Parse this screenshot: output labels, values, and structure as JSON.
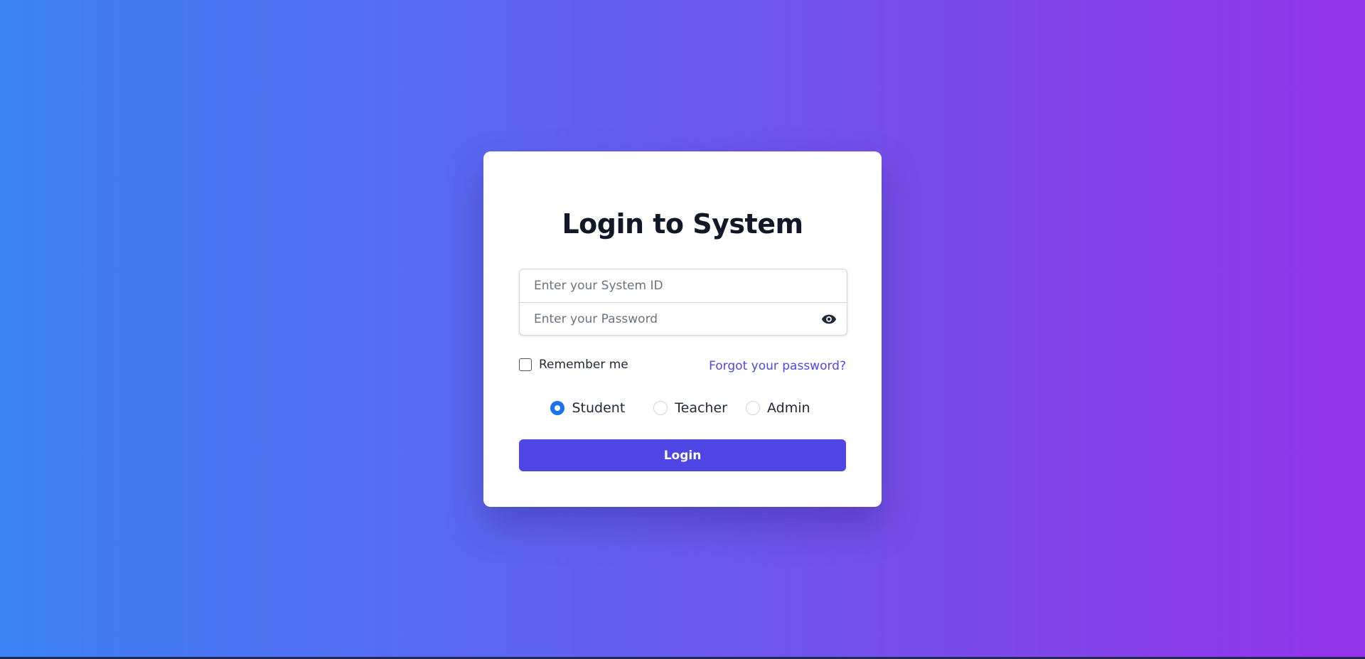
{
  "login": {
    "title": "Login to System",
    "system_id_placeholder": "Enter your System ID",
    "password_placeholder": "Enter your Password",
    "show_password_icon": "eye-icon",
    "remember_label": "Remember me",
    "remember_checked": false,
    "forgot_label": "Forgot your password?",
    "roles": [
      {
        "label": "Student",
        "checked": true
      },
      {
        "label": "Teacher",
        "checked": false
      },
      {
        "label": "Admin",
        "checked": false
      }
    ],
    "login_label": "Login"
  },
  "colors": {
    "gradient_start": "#3b82f6",
    "gradient_end": "#9333ea",
    "accent": "#4f46e5",
    "radio_selected": "#1d6ff2"
  }
}
